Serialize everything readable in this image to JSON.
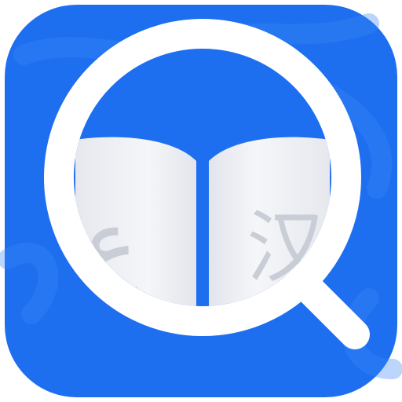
{
  "app_icon": {
    "name": "dictionary-search-app-icon",
    "glyph_left": "ع",
    "glyph_right": "汉",
    "colors": {
      "background": "#1d6ff0",
      "background_wave": "#2a7cf3",
      "ring": "#ffffff",
      "book_page": "#f3f4f8",
      "book_page_shadow": "#dfe2ea",
      "spine": "#1d6ff0",
      "glyph": "#c9cdd6"
    }
  }
}
